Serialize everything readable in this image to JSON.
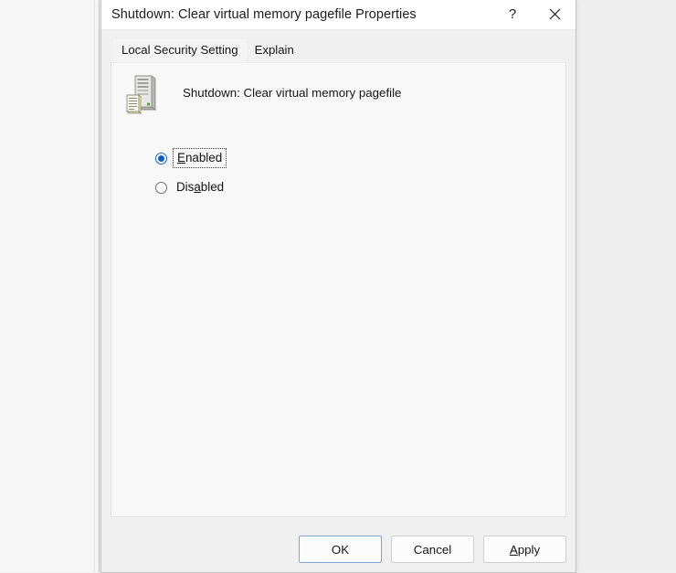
{
  "window": {
    "title": "Shutdown: Clear virtual memory pagefile Properties",
    "help_glyph": "?",
    "close_glyph": "✕"
  },
  "tabs": [
    {
      "label": "Local Security Setting",
      "active": true
    },
    {
      "label": "Explain",
      "active": false
    }
  ],
  "policy": {
    "icon_name": "server-policy-icon",
    "caption": "Shutdown: Clear virtual memory pagefile"
  },
  "options": [
    {
      "label": "Enabled",
      "accel": "E",
      "selected": true,
      "focused": true
    },
    {
      "label": "Disabled",
      "accel": "a",
      "selected": false,
      "focused": false
    }
  ],
  "footer": {
    "ok_label": "OK",
    "cancel_label": "Cancel",
    "apply_label": "Apply",
    "apply_accel": "A"
  },
  "colors": {
    "accent": "#0b5fc0",
    "default_button_border": "#7aa7d4",
    "dialog_bg": "#f0f0f0",
    "panel_bg": "#f8f8f8",
    "titlebar_bg": "#ffffff",
    "desktop_bg": "#efefef"
  }
}
